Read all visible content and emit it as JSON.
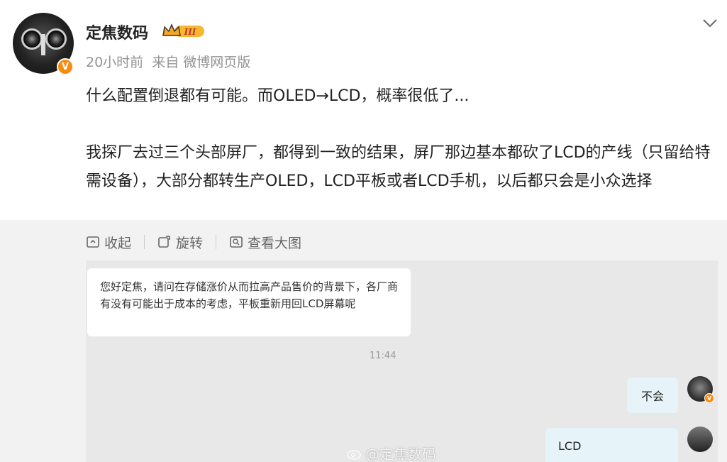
{
  "post": {
    "username": "定焦数码",
    "level_badge": "III",
    "time": "20小时前",
    "source": "来自 微博网页版",
    "line1": "什么配置倒退都有可能。而OLED→LCD，概率很低了...",
    "line2": "我探厂去过三个头部屏厂，都得到一致的结果，屏厂那边基本都砍了LCD的产线（只留给特需设备），大部分都转生产OLED，LCD平板或者LCD手机，以后都只会是小众选择"
  },
  "toolbar": {
    "collapse": "收起",
    "rotate": "旋转",
    "view_large": "查看大图"
  },
  "chat": {
    "question": "您好定焦，请问在存储涨价从而拉高产品售价的背景下，各厂商有没有可能出于成本的考虑，平板重新用回LCD屏幕呢",
    "time": "11:44",
    "reply1": "不会",
    "reply2": "LCD",
    "watermark": "@定焦数码"
  },
  "colors": {
    "accent": "#f78b0f",
    "bubble_right": "#e6f3f8"
  }
}
